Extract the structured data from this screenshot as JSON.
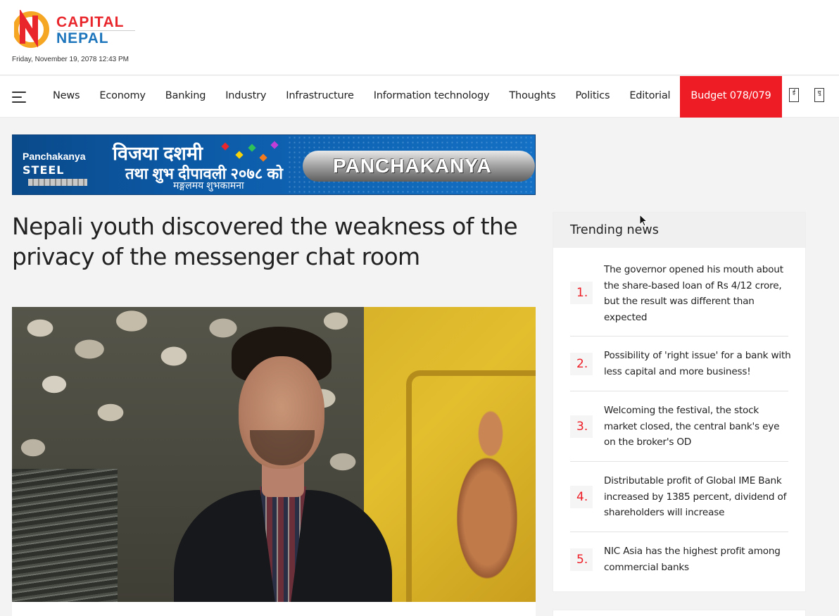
{
  "site": {
    "logo_line1": "CAPITAL",
    "logo_line2": "NEPAL",
    "date": "Friday, November 19, 2078 12:43 PM"
  },
  "nav": {
    "items": [
      {
        "label": "News"
      },
      {
        "label": "Economy"
      },
      {
        "label": "Banking"
      },
      {
        "label": "Industry"
      },
      {
        "label": "Infrastructure"
      },
      {
        "label": "Information technology"
      },
      {
        "label": "Thoughts"
      },
      {
        "label": "Politics"
      },
      {
        "label": "Editorial"
      }
    ],
    "budget_label": "Budget 078/079",
    "icon1": "ई",
    "icon2": "यु",
    "accent_color": "#ee1c25"
  },
  "ad": {
    "brand_line1": "Panchakanya",
    "brand_line2": "STEEL",
    "greeting_line1": "विजया दशमी",
    "greeting_line2": "तथा शुभ दीपावली २०७८ को",
    "greeting_line3": "मङ्गलमय शुभकामना",
    "pipe_text": "PANCHAKANYA"
  },
  "article": {
    "title": "Nepali youth discovered the weakness of the privacy of the messenger chat room"
  },
  "trending": {
    "heading": "Trending news",
    "items": [
      {
        "num": "1.",
        "text": "The governor opened his mouth about the share-based loan of Rs 4/12 crore, but the result was different than expected"
      },
      {
        "num": "2.",
        "text": "Possibility of 'right issue' for a bank with less capital and more business!"
      },
      {
        "num": "3.",
        "text": "Welcoming the festival, the stock market closed, the central bank's eye on the broker's OD"
      },
      {
        "num": "4.",
        "text": "Distributable profit of Global IME Bank increased by 1385 percent, dividend of shareholders will increase"
      },
      {
        "num": "5.",
        "text": "NIC Asia has the highest profit among commercial banks"
      }
    ]
  }
}
